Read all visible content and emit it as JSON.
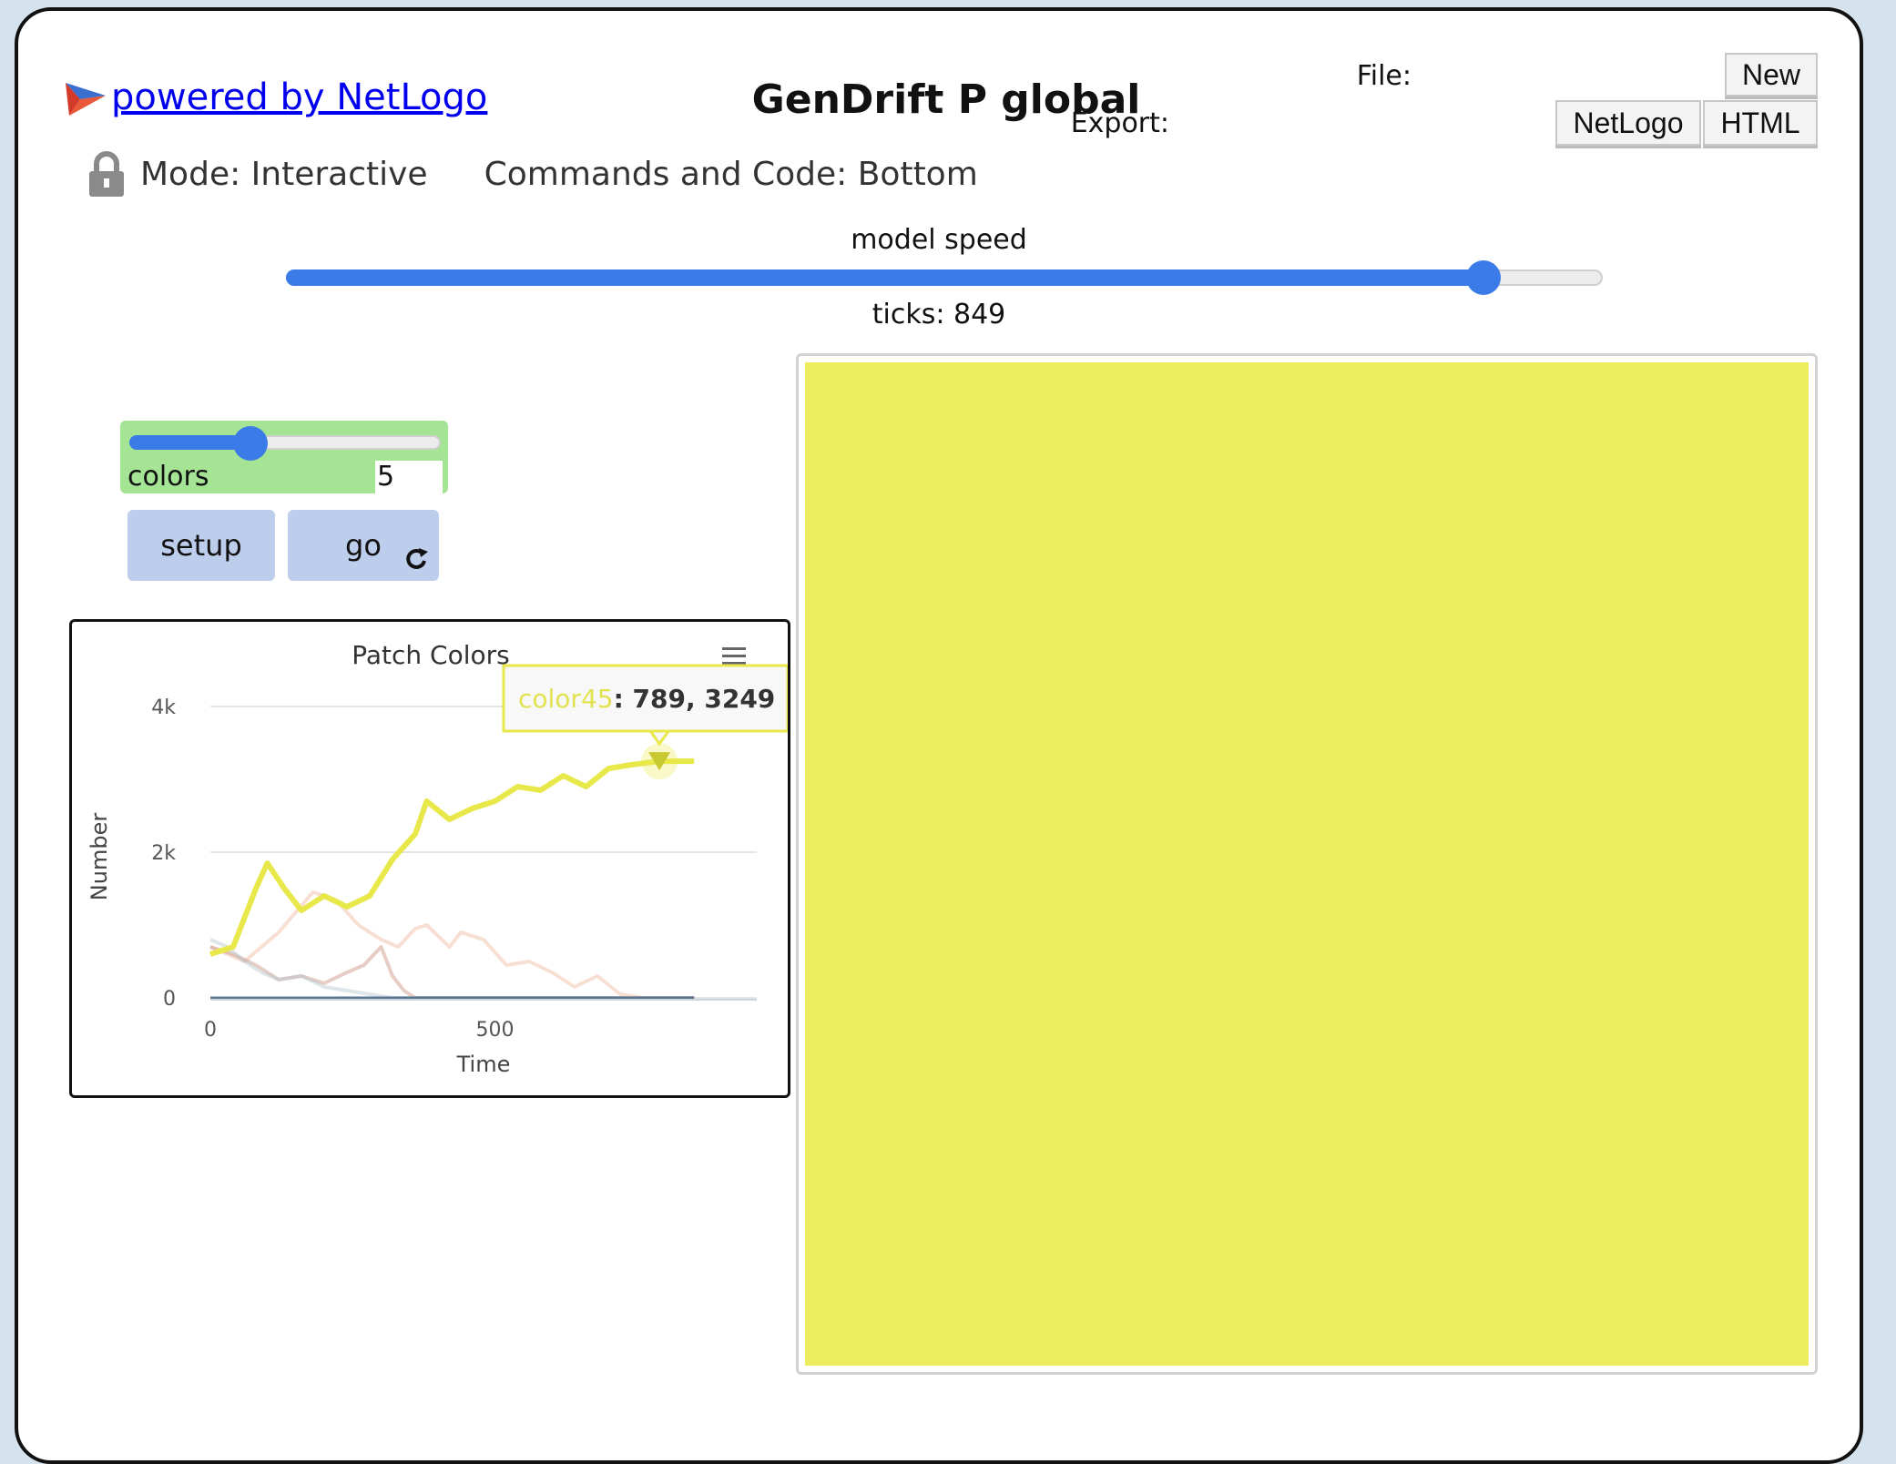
{
  "header": {
    "powered_by": "powered by NetLogo",
    "model_title": "GenDrift P global",
    "file_label": "File:",
    "new_button": "New",
    "export_label": "Export:",
    "export_netlogo": "NetLogo",
    "export_html": "HTML"
  },
  "mode_bar": {
    "mode": "Mode: Interactive",
    "commands": "Commands and Code: Bottom"
  },
  "speed": {
    "label": "model speed",
    "ticks": "ticks: 849",
    "value_fraction": 0.91
  },
  "slider_colors": {
    "name": "colors",
    "value": "5",
    "fraction": 0.33
  },
  "buttons": {
    "setup": "setup",
    "go": "go"
  },
  "plot": {
    "title": "Patch Colors",
    "tooltip_series": "color45",
    "tooltip_value": ": 789, 3249"
  },
  "chart_data": {
    "type": "line",
    "title": "Patch Colors",
    "xlabel": "Time",
    "ylabel": "Number",
    "xlim": [
      0,
      960
    ],
    "ylim": [
      0,
      4000
    ],
    "x_ticks": [
      0,
      500
    ],
    "y_ticks": [
      "0",
      "2k",
      "4k"
    ],
    "grid": true,
    "series": [
      {
        "name": "color45",
        "color": "#e8e84a",
        "x": [
          0,
          40,
          80,
          100,
          130,
          160,
          200,
          240,
          280,
          320,
          360,
          380,
          420,
          460,
          500,
          540,
          580,
          620,
          660,
          700,
          740,
          789,
          850
        ],
        "y": [
          600,
          700,
          1500,
          1850,
          1500,
          1200,
          1400,
          1250,
          1400,
          1900,
          2250,
          2700,
          2450,
          2600,
          2700,
          2900,
          2850,
          3050,
          2900,
          3150,
          3200,
          3249,
          3249
        ]
      },
      {
        "name": "",
        "color": "#f0b8a0",
        "x": [
          0,
          60,
          120,
          180,
          220,
          260,
          300,
          330,
          360,
          380,
          420,
          440,
          480,
          520,
          560,
          600,
          640,
          680,
          720,
          760,
          850
        ],
        "y": [
          700,
          500,
          900,
          1450,
          1350,
          1000,
          800,
          700,
          950,
          1000,
          700,
          900,
          800,
          450,
          500,
          350,
          150,
          300,
          50,
          0,
          0
        ]
      },
      {
        "name": "",
        "color": "#c89080",
        "x": [
          0,
          40,
          80,
          120,
          160,
          200,
          240,
          270,
          300,
          320,
          340,
          360,
          850
        ],
        "y": [
          700,
          600,
          450,
          250,
          300,
          200,
          350,
          450,
          700,
          300,
          100,
          0,
          0
        ]
      },
      {
        "name": "",
        "color": "#b8c8d0",
        "x": [
          0,
          30,
          60,
          90,
          120,
          160,
          200,
          240,
          280,
          320,
          850
        ],
        "y": [
          800,
          700,
          500,
          350,
          250,
          300,
          150,
          100,
          50,
          0,
          0
        ]
      },
      {
        "name": "",
        "color": "#4a6a88",
        "x": [
          0,
          850
        ],
        "y": [
          0,
          0
        ]
      }
    ]
  }
}
